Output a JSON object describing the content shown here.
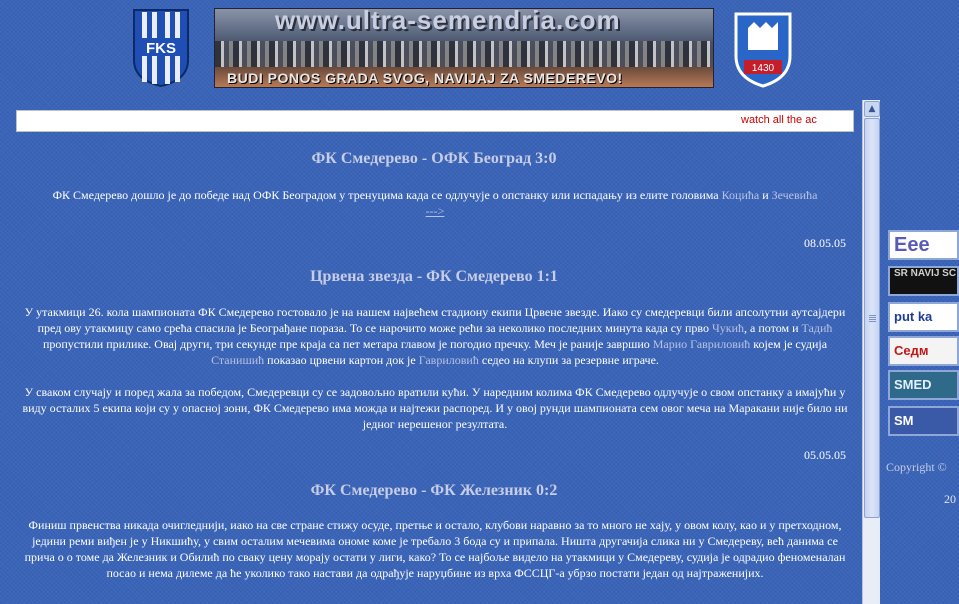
{
  "header": {
    "fks_logo_text": "FKS",
    "banner_url": "www.ultra-semendria.com",
    "banner_slogan": "BUDI PONOS GRADA SVOG, NAVIJAJ ZA SMEDEREVO!",
    "crest_year": "1430"
  },
  "marquee": {
    "text": "watch all the ac"
  },
  "articles": [
    {
      "title": "ФК Смедерево - ОФК Београд 3:0",
      "body_start": "ФК Смедерево дошло је до победе над ОФК Београдом у тренуцима када се одлучује о опстанку или испадању из елите головима ",
      "link1": "Коцића",
      "body_mid": " и ",
      "link2": "Зечевића",
      "more": "--->",
      "date": "08.05.05"
    },
    {
      "title": "Црвена звезда - ФК Смедерево 1:1",
      "p1_a": "У утакмици 26. кола шампионата ФК Смедерево гостовало је на нашем највећем стадиону екипи Црвене звезде. Иако су смедеревци били апсолутни аутсајдери пред ову утакмицу само срећа спасила је Београђане пораза. То се нарочито може рећи за неколико последних минута када су прво ",
      "p1_l1": "Чукић",
      "p1_b": ", а потом и ",
      "p1_l2": "Тадић",
      "p1_c": " пропустили прилике. Овај други, три секунде пре краја са пет метара главом је погодио пречку. Меч је раније завршио ",
      "p1_l3": "Марио Гавриловић",
      "p1_d": " којем је судија ",
      "p1_l4": "Станишић",
      "p1_e": " показао црвени картон док је ",
      "p1_l5": "Гавриловић",
      "p1_f": " седео на клупи за резервне играче.",
      "p2": "У сваком случају и поред жала за победом, Смедеревци су се задовољно вратили кући. У наредним колима ФК Смедерево одлучује о свом опстанку а имајући у виду осталих 5 екипа који су у опасној зони, ФК Смедерево има можда и најтежи распоред. И у овој рунди шампионата сем овог меча на Маракани није било ни једног нерешеног резултата.",
      "date": "05.05.05"
    },
    {
      "title": "ФК Смедерево - ФК Железник 0:2",
      "p1": "Финиш првенства никада очигледнији, иако на све стране стижу осуде, претње и остало, клубови наравно за то много не хају, у овом колу, као и у претходном, једини реми виђен је у Никшићу, у свим осталим мечевима ономе коме је требало 3 бода су и припала. Ништа другачија слика ни у Смедереву, већ данима се прича о о томе да Железник и Обилић по сваку цену морају остати у лиги, како? То се најбоље видело на утакмици у Смедереву, судија је одрадио феноменалан посао и нема дилеме да ће уколико тако настави да одрађује наруџбине из врха ФССЦГ-а убрзо постати један од најтраженијих."
    }
  ],
  "scrollbar": {
    "up_arrow": "▲"
  },
  "sidebar_ads": [
    {
      "label": "Eee",
      "bg": "#ffffff",
      "fg": "#5a5ab8"
    },
    {
      "label": "SR NAVIJ SC",
      "bg": "#111111",
      "fg": "#d0d0d0"
    },
    {
      "label": "put ka",
      "bg": "#ffffff",
      "fg": "#1d3c9a"
    },
    {
      "label": "Седм",
      "bg": "#f4f4f4",
      "fg": "#c01818"
    },
    {
      "label": "SMED",
      "bg": "#2f6a8a",
      "fg": "#e0f0ff"
    },
    {
      "label": "SM",
      "bg": "#3a5aa8",
      "fg": "#ffffff"
    }
  ],
  "footer": {
    "copyright": "Copyright ©",
    "year": "20"
  }
}
